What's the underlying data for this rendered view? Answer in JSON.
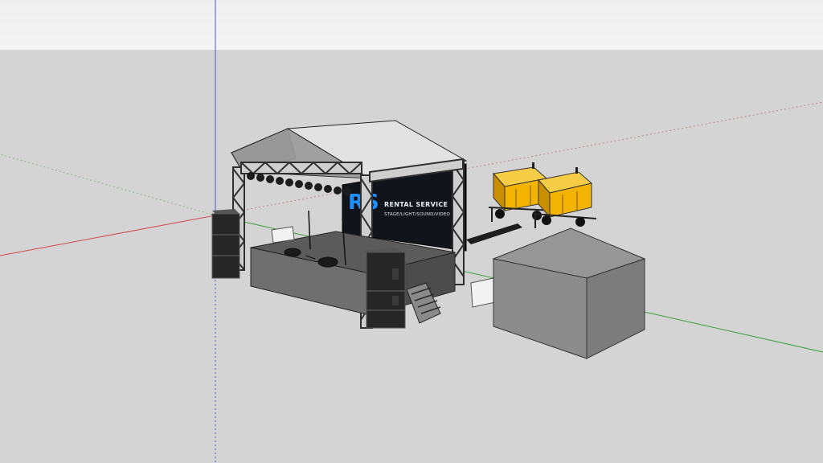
{
  "app": {
    "title": "3D model viewport",
    "colors": {
      "sky_top": "#efefef",
      "sky_bottom": "#f4f4f4",
      "ground": "#d4d4d4",
      "axis_red": "#d24a4a",
      "axis_green": "#3aa13a",
      "axis_blue": "#4a5ad2",
      "generator_yellow": "#f2b400",
      "banner_blue": "#1e90ff",
      "tent_gray": "#8e8e8e",
      "truss_dark": "#2f2f2f"
    }
  },
  "scene": {
    "banner": {
      "logo_text": "RS",
      "title": "RENTAL SERVICE",
      "subtitle": "STAGE/LIGHT/SOUND/VIDEO"
    },
    "objects": [
      {
        "name": "stage-structure",
        "icon": "stage-icon"
      },
      {
        "name": "speaker-stack-left",
        "icon": "speaker-icon"
      },
      {
        "name": "speaker-stack-right",
        "icon": "speaker-icon"
      },
      {
        "name": "generator-1",
        "icon": "generator-icon"
      },
      {
        "name": "generator-2",
        "icon": "generator-icon"
      },
      {
        "name": "pyramid-tent",
        "icon": "tent-icon"
      }
    ]
  }
}
